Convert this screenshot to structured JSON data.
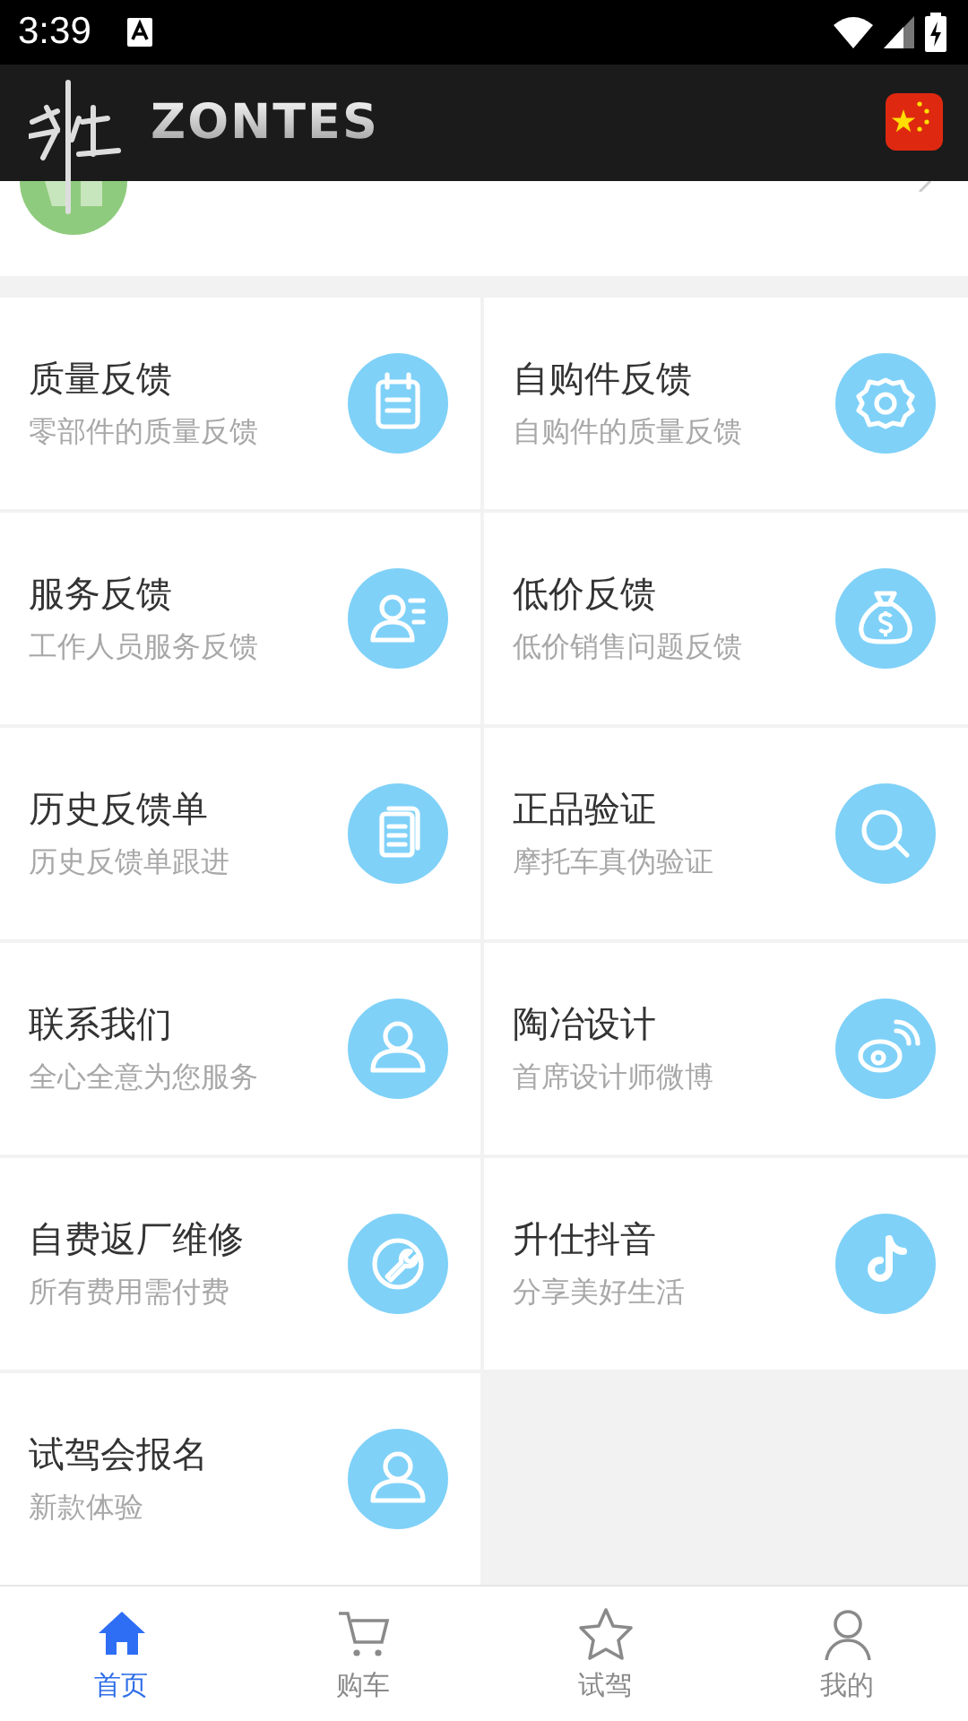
{
  "status_bar": {
    "time": "3:39"
  },
  "header": {
    "brand": "ZONTES"
  },
  "menu": [
    {
      "title": "质量反馈",
      "subtitle": "零部件的质量反馈"
    },
    {
      "title": "自购件反馈",
      "subtitle": "自购件的质量反馈"
    },
    {
      "title": "服务反馈",
      "subtitle": "工作人员服务反馈"
    },
    {
      "title": "低价反馈",
      "subtitle": "低价销售问题反馈"
    },
    {
      "title": "历史反馈单",
      "subtitle": "历史反馈单跟进"
    },
    {
      "title": "正品验证",
      "subtitle": "摩托车真伪验证"
    },
    {
      "title": "联系我们",
      "subtitle": "全心全意为您服务"
    },
    {
      "title": "陶冶设计",
      "subtitle": "首席设计师微博"
    },
    {
      "title": "自费返厂维修",
      "subtitle": "所有费用需付费"
    },
    {
      "title": "升仕抖音",
      "subtitle": "分享美好生活"
    },
    {
      "title": "试驾会报名",
      "subtitle": "新款体验"
    }
  ],
  "tab_bar": [
    {
      "label": "首页",
      "selected": true
    },
    {
      "label": "购车",
      "selected": false
    },
    {
      "label": "试驾",
      "selected": false
    },
    {
      "label": "我的",
      "selected": false
    }
  ]
}
